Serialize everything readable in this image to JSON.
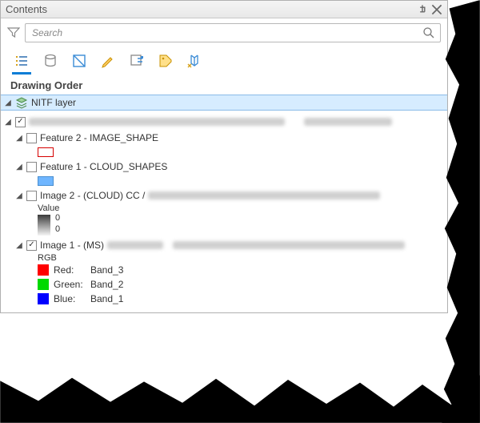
{
  "panel": {
    "title": "Contents"
  },
  "search": {
    "placeholder": "Search"
  },
  "section": {
    "drawing_order": "Drawing Order"
  },
  "layer": {
    "name": "NITF layer"
  },
  "tree": {
    "feature2": {
      "label": "Feature 2 - IMAGE_SHAPE"
    },
    "feature1": {
      "label": "Feature 1 - CLOUD_SHAPES"
    },
    "image2": {
      "label_prefix": "Image 2 - (CLOUD) CC / ",
      "value_header": "Value",
      "grad_top": "0",
      "grad_bottom": "0"
    },
    "image1": {
      "label_prefix": "Image 1 - (MS) ",
      "rgb_header": "RGB",
      "red": {
        "label": "Red:",
        "band": "Band_3"
      },
      "green": {
        "label": "Green:",
        "band": "Band_2"
      },
      "blue": {
        "label": "Blue:",
        "band": "Band_1"
      }
    }
  }
}
